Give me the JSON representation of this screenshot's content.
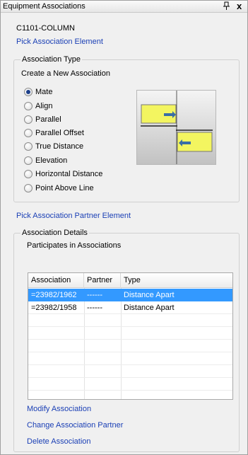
{
  "panel": {
    "title": "Equipment Associations",
    "pin_icon": "pin-icon",
    "close_icon": "close-icon",
    "close_glyph": "x"
  },
  "element_name": "C1101-COLUMN",
  "pick_element_link": "Pick Association Element",
  "association_type": {
    "title": "Association Type",
    "subtitle": "Create a New Association",
    "selected": "Mate",
    "options": [
      "Mate",
      "Align",
      "Parallel",
      "Parallel Offset",
      "True Distance",
      "Elevation",
      "Horizontal Distance",
      "Point Above Line"
    ],
    "preview_colors": {
      "box": "#f3f560",
      "arrow": "#3a6ea5"
    }
  },
  "pick_partner_link": "Pick Association Partner Element",
  "details": {
    "title": "Association Details",
    "participates_label": "Participates in Associations",
    "columns": [
      "Association",
      "Partner",
      "Type"
    ],
    "rows": [
      {
        "association": "=23982/1962",
        "partner": "------",
        "type": "Distance Apart",
        "selected": true
      },
      {
        "association": "=23982/1958",
        "partner": "------",
        "type": "Distance Apart",
        "selected": false
      }
    ]
  },
  "actions": {
    "modify": "Modify Association",
    "change_partner": "Change Association Partner",
    "delete": "Delete Association"
  },
  "colors": {
    "link": "#1a3fb5",
    "selection": "#3399ff"
  }
}
